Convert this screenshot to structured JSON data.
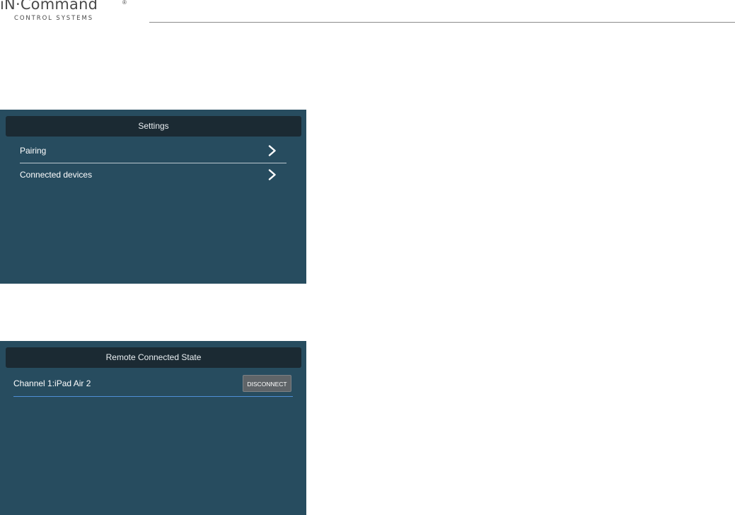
{
  "logo": {
    "main": "iN·Command",
    "registered": "®",
    "sub": "CONTROL SYSTEMS"
  },
  "settings": {
    "title": "Settings",
    "items": [
      {
        "label": "Pairing",
        "icon": "chevron-right-icon"
      },
      {
        "label": "Connected devices",
        "icon": "chevron-right-icon"
      }
    ]
  },
  "remote": {
    "title": "Remote Connected State",
    "device": {
      "label": "Channel 1:iPad Air 2",
      "action": "DISCONNECT"
    }
  },
  "colors": {
    "panel_bg": "#274c5f",
    "title_bar_bg": "#1b2a33",
    "divider_light": "#b9c7cf",
    "divider_accent": "#4f8ed6",
    "button_bg": "#5f6468",
    "logo_text": "#4a4a4a"
  }
}
